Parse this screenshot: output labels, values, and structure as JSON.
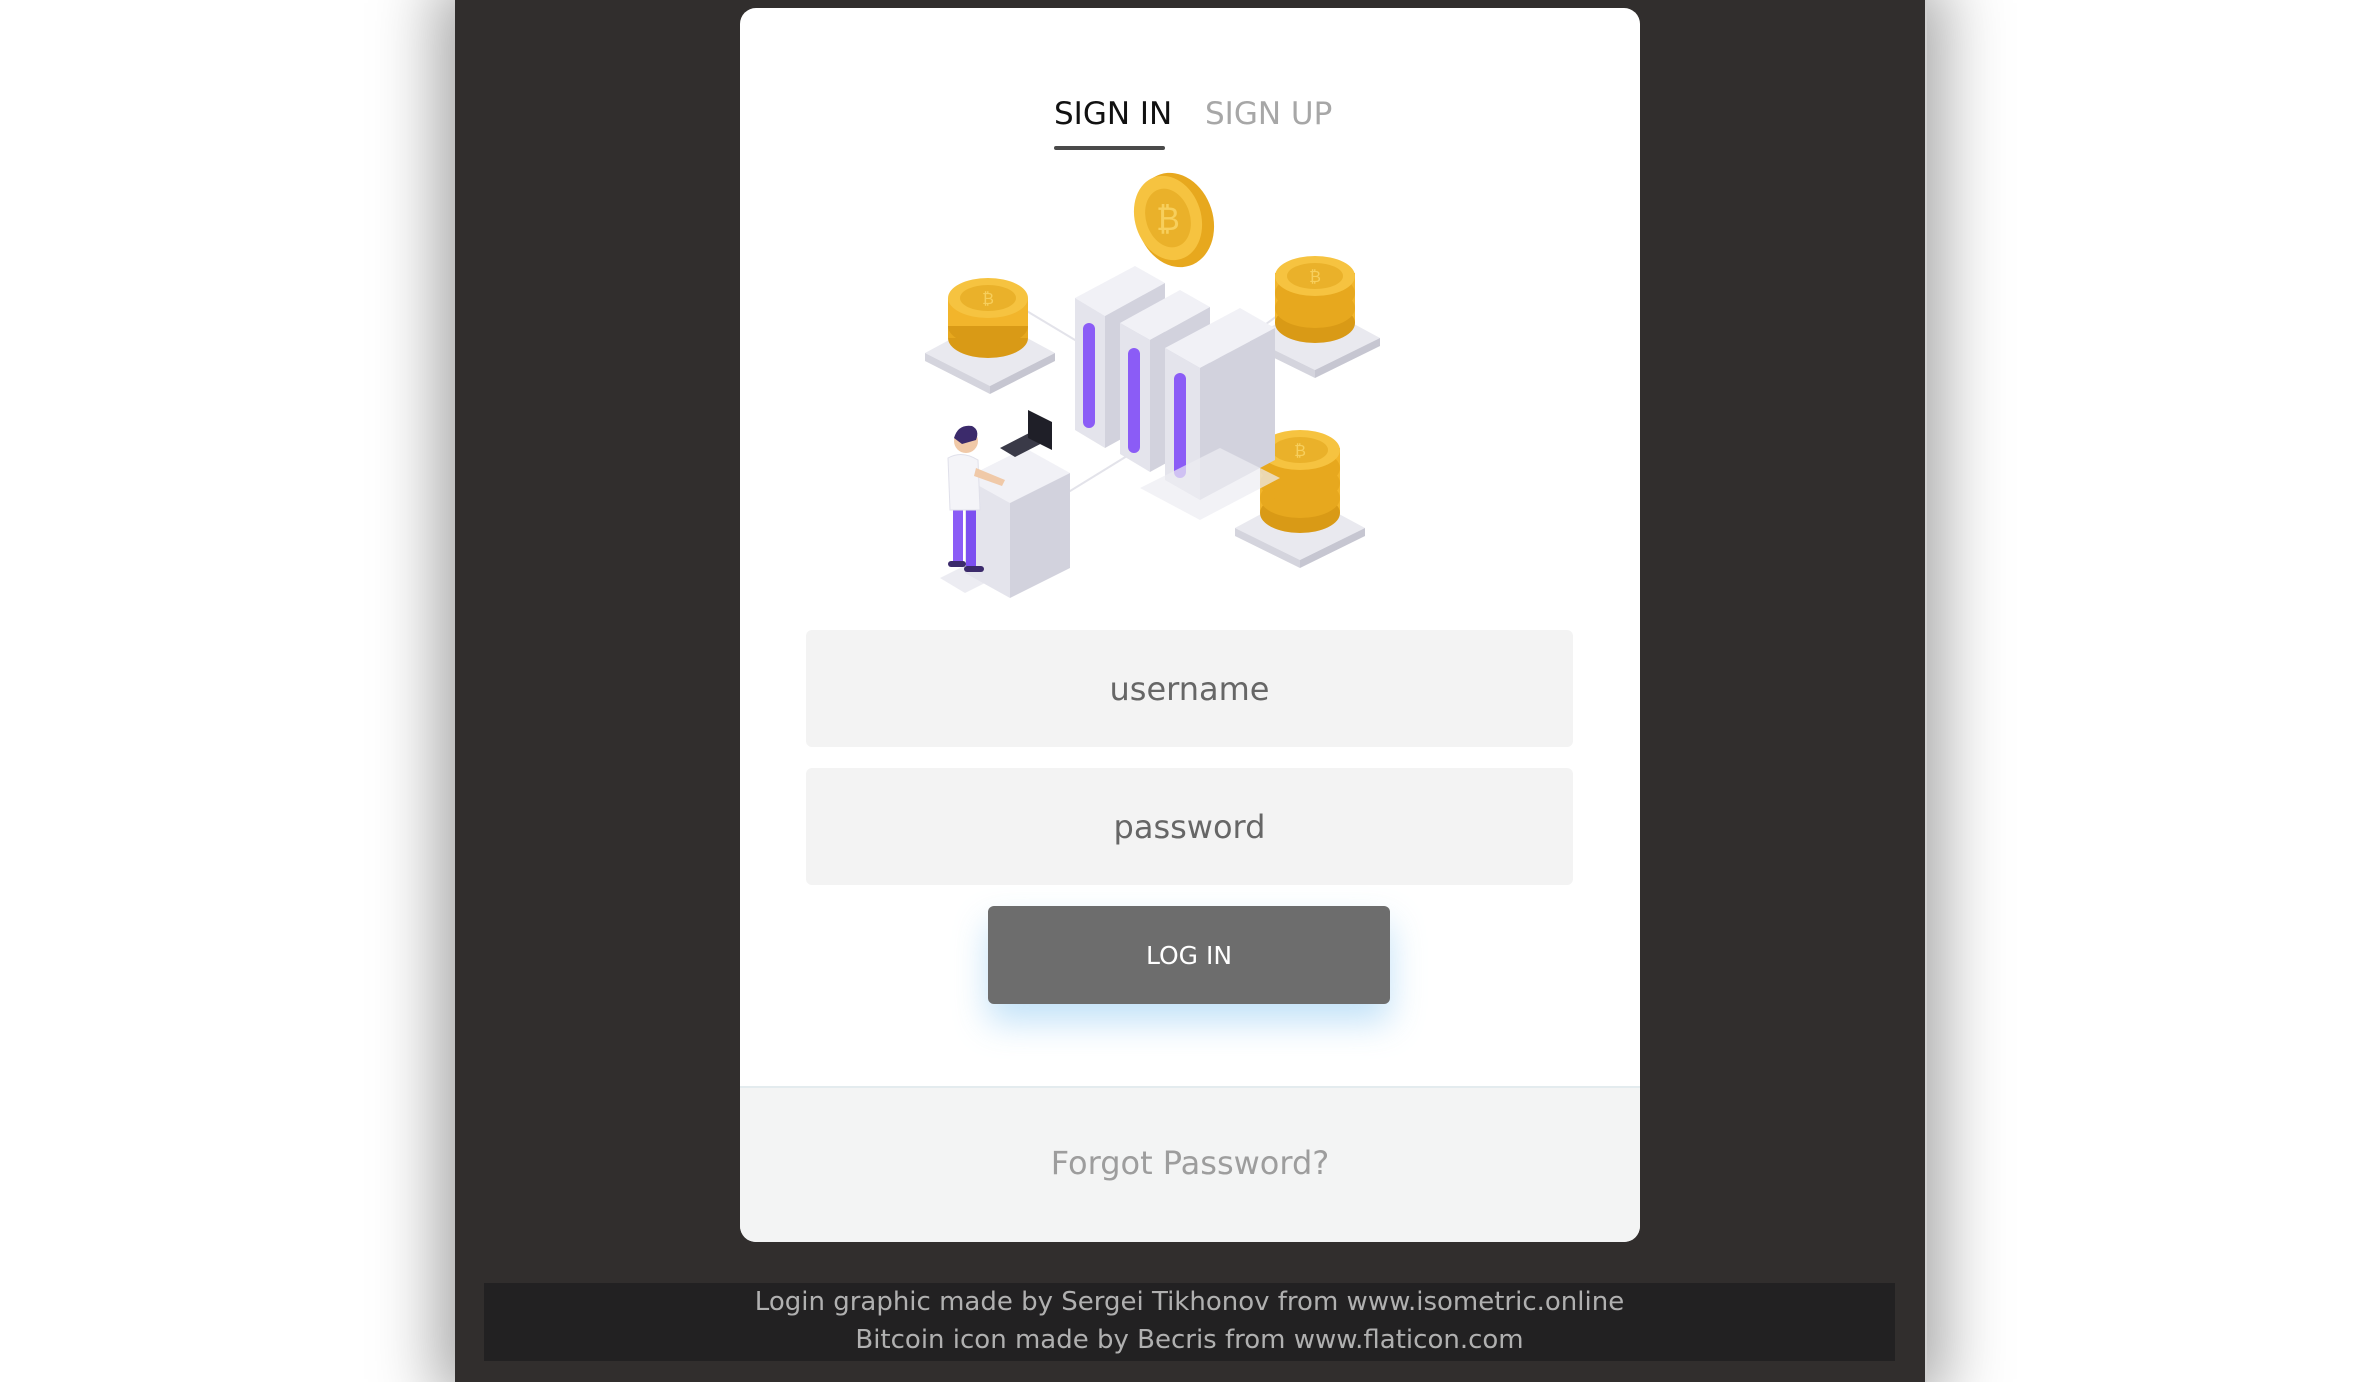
{
  "tabs": {
    "sign_in": "SIGN IN",
    "sign_up": "SIGN UP",
    "active": "sign_in"
  },
  "form": {
    "username_placeholder": "username",
    "password_placeholder": "password",
    "login_label": "LOG IN"
  },
  "footer": {
    "forgot_label": "Forgot Password?"
  },
  "credits": {
    "line1": "Login graphic made by Sergei Tikhonov from www.isometric.online",
    "line2": "Bitcoin icon made by Becris from www.flaticon.com"
  },
  "colors": {
    "page_background": "#312e2d",
    "card_background": "#ffffff",
    "button_background": "#6d6d6d",
    "coin_gold": "#f2b52b",
    "server_accent": "#8b5cf6"
  }
}
